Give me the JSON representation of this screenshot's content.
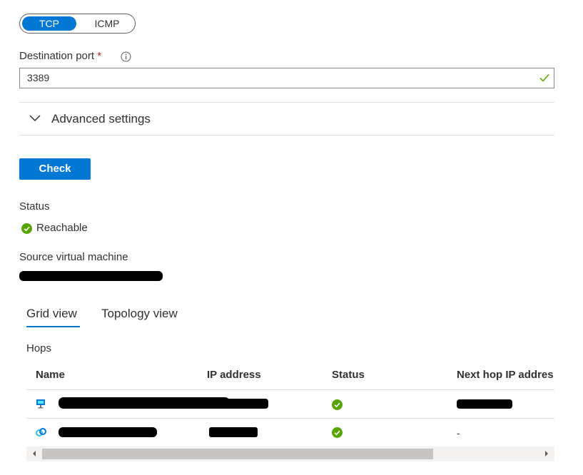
{
  "protocol": {
    "options": [
      "TCP",
      "ICMP"
    ],
    "selected": "TCP"
  },
  "destination_port": {
    "label": "Destination port",
    "required_mark": "*",
    "value": "3389",
    "valid": true
  },
  "advanced_settings": {
    "label": "Advanced settings"
  },
  "actions": {
    "check_label": "Check"
  },
  "result": {
    "status_label": "Status",
    "status_value": "Reachable",
    "source_vm_label": "Source virtual machine"
  },
  "views": {
    "tabs": [
      "Grid view",
      "Topology view"
    ],
    "active": "Grid view"
  },
  "hops": {
    "title": "Hops",
    "columns": [
      "Name",
      "IP address",
      "Status",
      "Next hop IP addres"
    ],
    "rows": [
      {
        "icon": "virtual-machine-icon",
        "name": "",
        "ip": "",
        "status": "ok",
        "next_hop": ""
      },
      {
        "icon": "network-interface-icon",
        "name": "",
        "ip": "",
        "status": "ok",
        "next_hop": "-"
      }
    ]
  },
  "colors": {
    "accent": "#0078d4",
    "success": "#57a300",
    "required": "#a4262c"
  }
}
